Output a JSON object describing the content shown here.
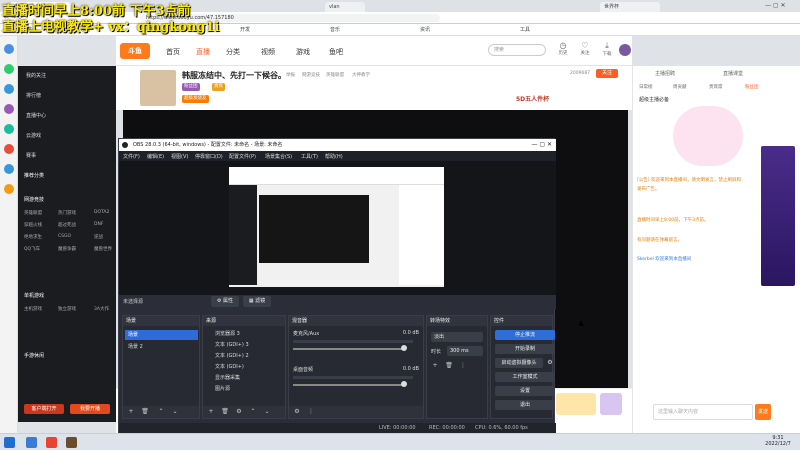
{
  "overlay": {
    "line1": "直播时间早上8:00前 下午3点前",
    "line2": "直播上电视教学+ vx：qingkong1i"
  },
  "browser": {
    "tabs": [
      "虎牙直播-主播...",
      "vlan",
      "世界杯",
      "obs",
      "在线",
      "EOS",
      "Thethy",
      "斗鱼"
    ],
    "address": "https://www.douyu.com/47.157180",
    "bookmarks": [
      "书签",
      "导航",
      "文档",
      "开发",
      "音乐",
      "资讯",
      "工具"
    ]
  },
  "site": {
    "logo": "斗鱼",
    "nav": [
      "首页",
      "直播",
      "分类",
      "视频",
      "游戏",
      "鱼吧"
    ],
    "active_nav": "直播",
    "search_placeholder": "搜索",
    "header_icons": [
      "历史",
      "关注",
      "下载",
      "开播"
    ]
  },
  "room": {
    "title": "韩服冻结中、先打一下候谷。",
    "meta": [
      "举报",
      "网游竞技",
      "英雄联盟",
      "大神教学"
    ],
    "follow": "关注",
    "badges": [
      "粉丝团",
      "贵宾",
      "超级发烧友"
    ],
    "banner": "5D五人件杯",
    "count": "2009687"
  },
  "sidebar": {
    "top_items": [
      "我的关注",
      "排行榜",
      "直播中心",
      "云游戏",
      "赛事"
    ],
    "section1": "推荐分类",
    "section2": "网游竞技",
    "section3": "单机游戏",
    "section4": "手游休闲",
    "subs": [
      [
        "英雄联盟",
        "热门游戏",
        "DOTA2"
      ],
      [
        "穿越火线",
        "超过死战",
        "DNF"
      ],
      [
        "绝地求生",
        "CSGO",
        "逆战"
      ],
      [
        "QQ飞车",
        "魔兽争霸",
        "魔兽世界"
      ],
      [
        "主机游戏",
        "独立游戏",
        "3A大作"
      ]
    ],
    "btn_open": "客户端打开",
    "btn_start": "我要开播"
  },
  "right": {
    "tabs": [
      "日常榜",
      "周贡献",
      "贵宾席",
      "粉丝团"
    ],
    "tabs_top": [
      "主播招聘",
      "直播课堂"
    ],
    "notice": "超级主播必备",
    "chat": [
      "[公告] 欢迎来到本直播间，请文明发言，禁止刷屏和发布广告。",
      "直播时间早上8:00前，下午3点前。",
      "有问题请在弹幕留言。"
    ],
    "chat_user": "Skerbel 欢迎来到本直播间",
    "input_placeholder": "这里输入聊天内容",
    "send": "发送"
  },
  "obs": {
    "title": "OBS 28.0.3 (64-bit, windows) - 配置文件: 未命名 - 场景: 未命名",
    "menus": [
      "文件(F)",
      "编辑(E)",
      "视图(V)",
      "停靠窗口(D)",
      "配置文件(P)",
      "场景集合(S)",
      "工具(T)",
      "帮助(H)"
    ],
    "no_source": "未选择源",
    "props_btn": "属性",
    "filter_btn": "滤镜",
    "docks": {
      "scenes": "场景",
      "sources": "来源",
      "mixer": "混音器",
      "transitions": "转场特效",
      "controls": "控件"
    },
    "scenes": [
      "场景",
      "场景 2"
    ],
    "sources": [
      "浏览器源 3",
      "文本 (GDI+) 3",
      "文本 (GDI+) 2",
      "文本 (GDI+)",
      "显示器采集",
      "图片源"
    ],
    "mixer": [
      {
        "name": "麦克风/Aux",
        "db": "0.0 dB"
      },
      {
        "name": "桌面音频",
        "db": "0.0 dB"
      }
    ],
    "transition": "淡出",
    "duration_label": "时长",
    "duration": "300 ms",
    "controls": [
      "停止推流",
      "开始录制",
      "启动虚拟摄像头",
      "工作室模式",
      "设置",
      "退出"
    ],
    "status": {
      "live": "LIVE: 00:00:00",
      "rec": "REC: 00:00:00",
      "cpu": "CPU: 0.6%, 60.00 fps"
    }
  },
  "taskbar": {
    "time": "9:31",
    "date": "2022/12/7"
  }
}
